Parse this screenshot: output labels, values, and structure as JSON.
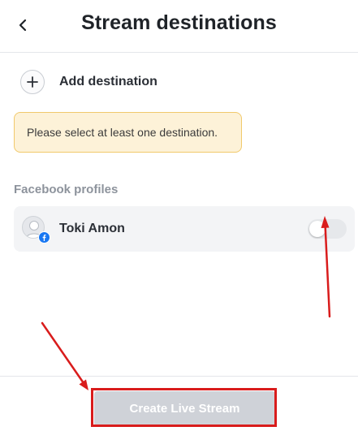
{
  "header": {
    "back_icon": "chevron-left-icon",
    "title": "Stream destinations"
  },
  "add_destination": {
    "icon": "plus-icon",
    "label": "Add destination"
  },
  "warning": {
    "text": "Please select at least one destination.",
    "bg_color": "#fdf2d8",
    "border_color": "#f1c96b"
  },
  "facebook_section": {
    "label": "Facebook profiles",
    "profiles": [
      {
        "name": "Toki Amon",
        "avatar_icon": "avatar-placeholder-icon",
        "badge_icon": "facebook-icon",
        "enabled": false
      }
    ]
  },
  "footer": {
    "create_button_label": "Create Live Stream",
    "create_button_state": "disabled"
  },
  "annotations": {
    "color": "#d91c1c",
    "arrow_targets": [
      "toggle",
      "create-live-stream-button"
    ]
  }
}
